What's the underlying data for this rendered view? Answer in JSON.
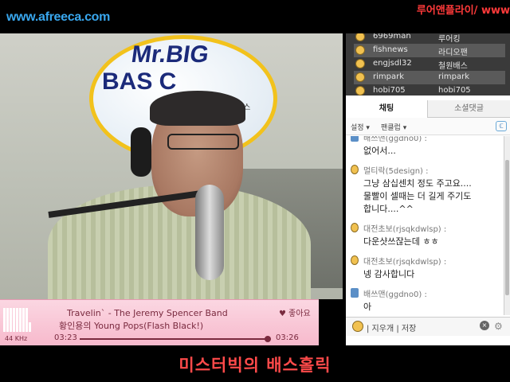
{
  "header": {
    "site_url": "www.afreeca.com",
    "marquee": "루어앤플라이/ www"
  },
  "video": {
    "sign_line1": "Mr.BIG",
    "sign_line2": "BAS    C",
    "sign_sub": "미스"
  },
  "player": {
    "track_title": "Travelin` - The Jeremy Spencer Band",
    "track_subtitle": "황인용의 Young Pops(Flash Black!)",
    "like_label": "♥ 좋아요",
    "sample_rate": "44 KHz",
    "elapsed": "03:23",
    "total": "03:26",
    "progress": 0.985
  },
  "users": [
    {
      "id": "6969man",
      "nick": "루어킹",
      "selected": false
    },
    {
      "id": "fishnews",
      "nick": "라디오팬",
      "selected": true
    },
    {
      "id": "engjsdl32",
      "nick": "철원배스",
      "selected": false
    },
    {
      "id": "rimpark",
      "nick": "rimpark",
      "selected": true
    },
    {
      "id": "hobi705",
      "nick": "hobi705",
      "selected": false
    }
  ],
  "tabs": {
    "chat": "채팅",
    "social": "소셜댓글"
  },
  "tools": {
    "settings": "설정 ▾",
    "fanclub": "팬클럽 ▾",
    "icon": "ℂ"
  },
  "messages": [
    {
      "who": "배쓰맨(ggdno0) :",
      "lines": [
        "없어서..."
      ],
      "icon": "phone"
    },
    {
      "who": "멀티락(5design) :",
      "lines": [
        "그냥 삼십센치 정도 주고요....",
        "물빨이 셀때는 더 길게 주기도",
        "합니다....^^"
      ],
      "icon": "face"
    },
    {
      "who": "대전초보(rjsqkdwlsp) :",
      "lines": [
        "다운샷쓰잖는데 ㅎㅎ"
      ],
      "icon": "face"
    },
    {
      "who": "대전초보(rjsqkdwlsp) :",
      "lines": [
        "넹 감사합니다"
      ],
      "icon": "face"
    },
    {
      "who": "배쓰맨(ggdno0) :",
      "lines": [
        "아"
      ],
      "icon": "phone"
    }
  ],
  "bottom": {
    "clear_save": "| 지우개 | 저장",
    "close": "×",
    "gear": "⚙"
  },
  "caption": "미스터빅의 배스홀릭",
  "colors": {
    "site": "#39a7ee",
    "caption": "#ff4a4a",
    "player_bg": "#f7b9cc"
  }
}
